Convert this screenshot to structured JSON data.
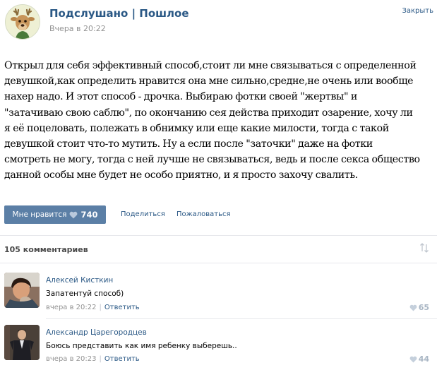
{
  "post": {
    "group_name": "Подслушано | Пошлое",
    "time": "Вчера в 20:22",
    "close_label": "Закрыть",
    "lines": [
      "Открыл для себя эффективный способ,стоит ли мне связываться с определенной",
      "девушкой,как определить нравится она мне сильно,средне,не очень или вообще",
      "нахер надо. И этот способ - дрочка. Выбираю фотки своей \"жертвы\" и",
      "\"затачиваю свою саблю\", по окончанию сея действа приходит озарение, хочу ли",
      "я её поцеловать, полежать в обнимку или еще какие милости, тогда с такой",
      "девушкой стоит что-то мутить. Ну а если после \"заточки\" даже на фотки",
      "смотреть не могу, тогда с ней лучше не связываться, ведь и после секса общество",
      "данной особы мне будет не особо приятно, и я просто захочу свалить."
    ]
  },
  "actions": {
    "like_label": "Мне нравится",
    "like_count": "740",
    "share_label": "Поделиться",
    "report_label": "Пожаловаться"
  },
  "comments_header": {
    "count_label": "105 комментариев"
  },
  "comments": [
    {
      "author": "Алексей Кисткин",
      "text": "Запатентуй способ)",
      "time": "вчера в 20:22",
      "reply_label": "Ответить",
      "likes": "65"
    },
    {
      "author": "Александр Царегородцев",
      "text": "Боюсь представить как имя ребенку выберешь..",
      "time": "вчера в 20:23",
      "reply_label": "Ответить",
      "likes": "44"
    }
  ],
  "colors": {
    "link": "#2a5885",
    "like_button": "#5b7fa6",
    "muted": "#939393"
  },
  "icons": [
    "group-avatar-deer",
    "heart-icon",
    "sort-icon"
  ]
}
